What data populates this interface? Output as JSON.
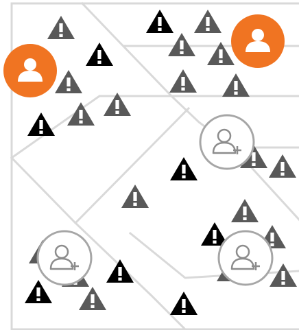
{
  "map": {
    "colors": {
      "road": "#d9d9d9",
      "warning_gray": "#595959",
      "warning_black": "#000000",
      "user_fill": "#f07422",
      "user_icon": "#ffffff",
      "add_user_ring": "#a6a6a6",
      "add_user_icon": "#8c8c8c",
      "add_user_fill": "#ffffff"
    },
    "icon_names": {
      "warning": "warning-triangle-icon",
      "user": "user-location-icon",
      "add_user": "add-user-icon"
    },
    "counts": {
      "warnings_gray": 21,
      "warnings_black": 9,
      "users": 2,
      "add_user_markers": 3
    }
  }
}
